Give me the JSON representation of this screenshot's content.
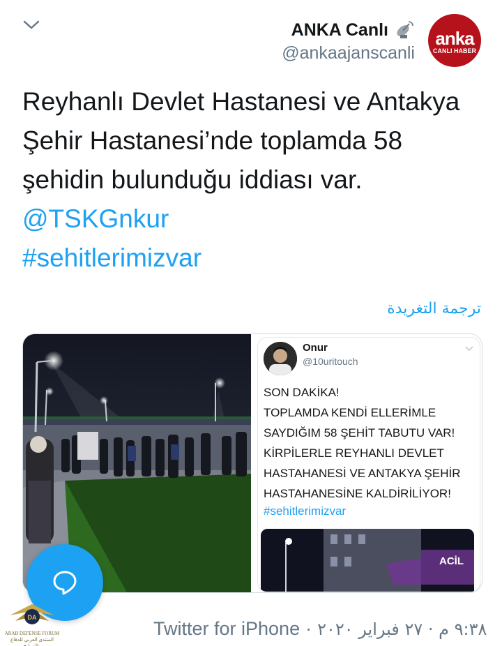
{
  "account": {
    "name": "ANKA Canlı",
    "handle": "@ankaajanscanli",
    "avatar_text": "anka",
    "avatar_subtext": "CANLI HABER"
  },
  "tweet": {
    "text_part1": "Reyhanlı Devlet Hastanesi ve Antakya Şehir Hastanesi’nde toplamda 58 şehidin bulunduğu iddiası var. ",
    "mention": "@TSKGnkur",
    "hashtag": "#sehitlerimizvar"
  },
  "translate_label": "ترجمة التغريدة",
  "quoted_card": {
    "name": "Onur",
    "handle": "@10uritouch",
    "text": "SON DAKİKA!\nTOPLAMDA KENDİ ELLERİMLE SAYDIĞIM 58 ŞEHİT TABUTU VAR! KİRPİLERLE REYHANLI DEVLET HASTAHANESİ VE ANTAKYA ŞEHİR HASTAHANESİNE KALDİRİLİYOR!",
    "hashtag": "#sehitlerimizvar",
    "photo_sign": "ACİL"
  },
  "footer": {
    "source": "Twitter for iPhone",
    "separator": "·",
    "timestamp": "٩:٣٨ م · ٢٧ فبراير ٢٠٢٠"
  },
  "watermark": {
    "line1": "ARAB DEFENSE FORUM",
    "line2": "المنتدى العربي للدفاع والتسليح"
  },
  "colors": {
    "link": "#1da1f2",
    "secondary_text": "#657786",
    "avatar_bg": "#b5121b"
  }
}
